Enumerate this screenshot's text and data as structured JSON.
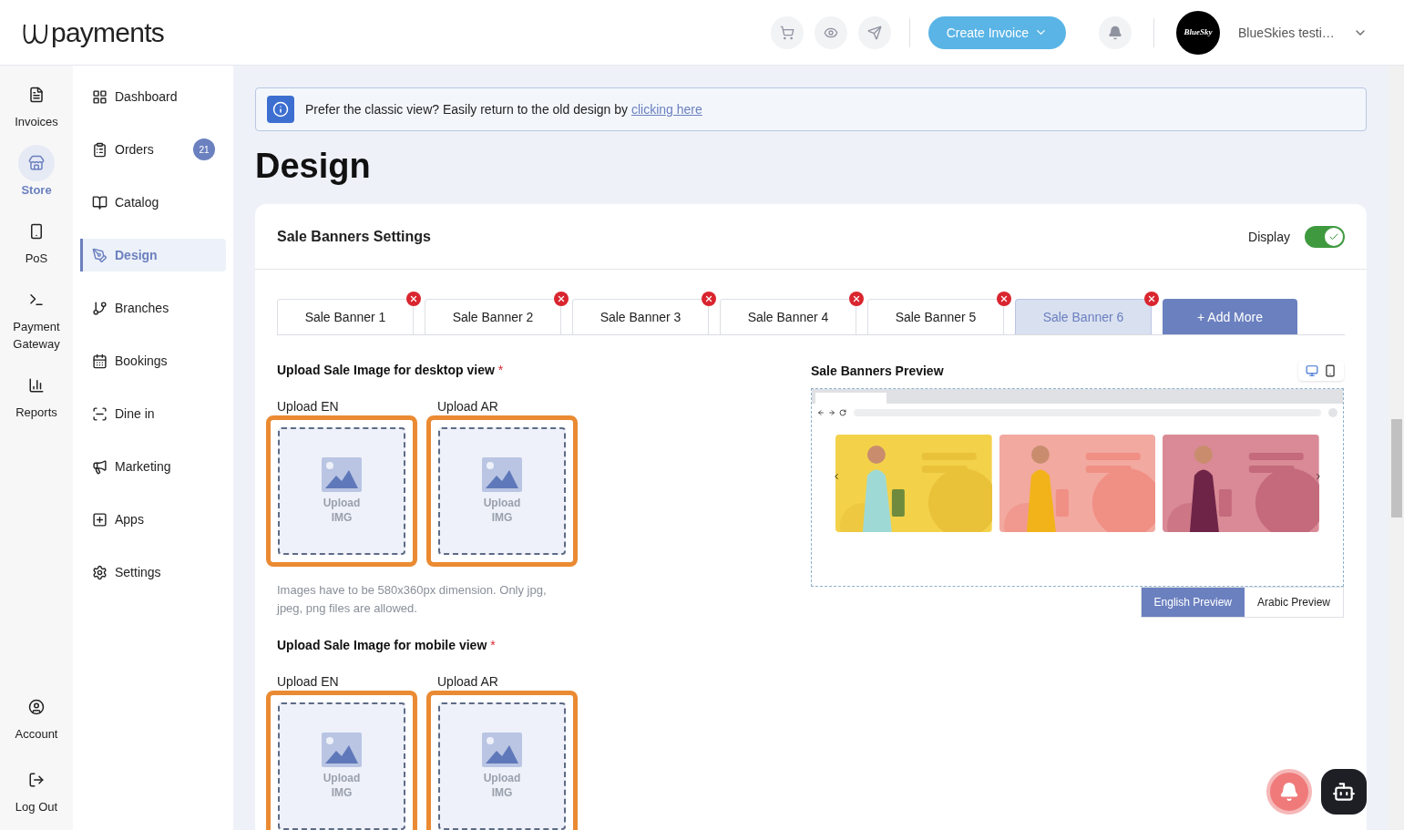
{
  "header": {
    "logo": "payments",
    "create_invoice": "Create Invoice",
    "account": {
      "avatar_text": "BlueSky",
      "name": "BlueSkies testi…"
    }
  },
  "rail": [
    {
      "label": "Invoices",
      "selected": false
    },
    {
      "label": "Store",
      "selected": true
    },
    {
      "label": "PoS",
      "selected": false
    },
    {
      "label": "Payment Gateway",
      "selected": false
    },
    {
      "label": "Reports",
      "selected": false
    }
  ],
  "rail_bottom": [
    {
      "label": "Account"
    },
    {
      "label": "Log Out"
    }
  ],
  "sidebar": [
    {
      "label": "Dashboard",
      "selected": false
    },
    {
      "label": "Orders",
      "selected": false,
      "badge": "21"
    },
    {
      "label": "Catalog",
      "selected": false
    },
    {
      "label": "Design",
      "selected": true
    },
    {
      "label": "Branches",
      "selected": false
    },
    {
      "label": "Bookings",
      "selected": false
    },
    {
      "label": "Dine in",
      "selected": false
    },
    {
      "label": "Marketing",
      "selected": false
    },
    {
      "label": "Apps",
      "selected": false
    },
    {
      "label": "Settings",
      "selected": false
    }
  ],
  "notice": {
    "text": "Prefer the classic view? Easily return to the old design by",
    "link": "clicking here"
  },
  "page_title": "Design",
  "card": {
    "title": "Sale Banners Settings",
    "display": {
      "label": "Display",
      "on": true
    },
    "tabs": [
      {
        "label": "Sale Banner 1",
        "selected": false
      },
      {
        "label": "Sale Banner 2",
        "selected": false
      },
      {
        "label": "Sale Banner 3",
        "selected": false
      },
      {
        "label": "Sale Banner 4",
        "selected": false
      },
      {
        "label": "Sale Banner 5",
        "selected": false
      },
      {
        "label": "Sale Banner 6",
        "selected": true
      }
    ],
    "add_more": "+ Add More",
    "sections": [
      {
        "title": "Upload Sale Image for desktop view",
        "required_mark": "*",
        "uploads": [
          {
            "label": "Upload EN",
            "text": "Upload IMG"
          },
          {
            "label": "Upload AR",
            "text": "Upload IMG"
          }
        ],
        "hint": "Images have to be 580x360px dimension. Only jpg, jpeg, png files are allowed."
      },
      {
        "title": "Upload Sale Image for mobile view",
        "required_mark": "*",
        "uploads": [
          {
            "label": "Upload EN",
            "text": "Upload IMG"
          },
          {
            "label": "Upload AR",
            "text": "Upload IMG"
          }
        ]
      }
    ],
    "preview": {
      "title": "Sale Banners Preview",
      "devices": [
        {
          "selected": true
        },
        {
          "selected": false
        }
      ],
      "languages": [
        {
          "label": "English Preview",
          "selected": true
        },
        {
          "label": "Arabic Preview",
          "selected": false
        }
      ]
    }
  }
}
